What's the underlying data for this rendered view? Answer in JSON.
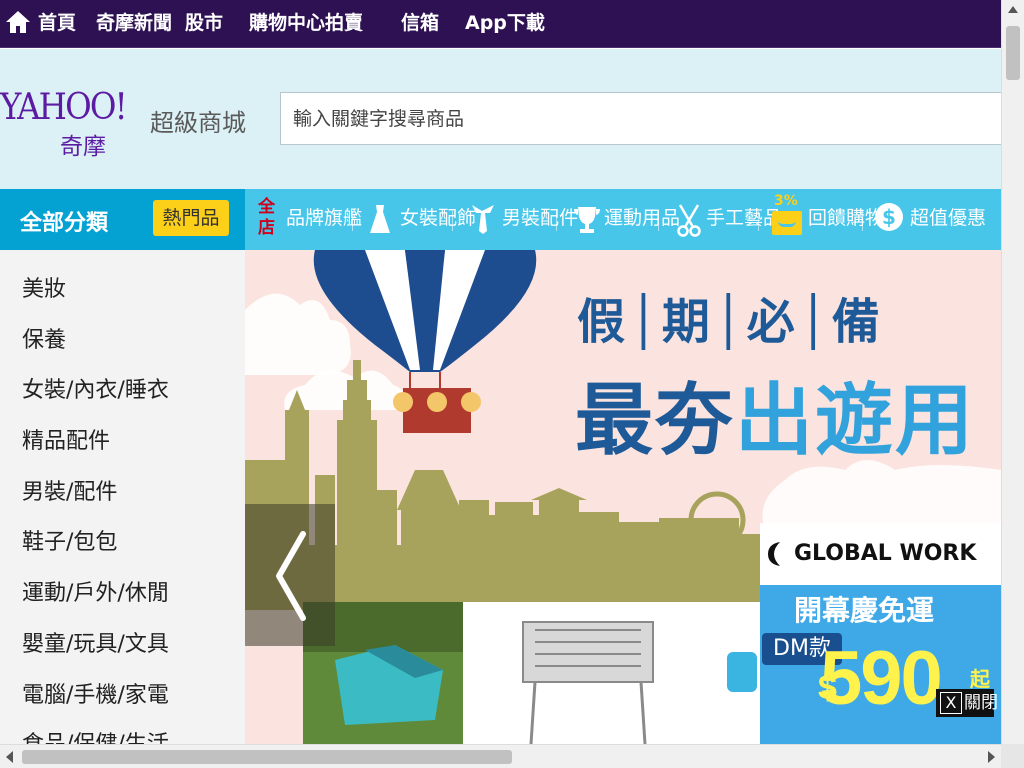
{
  "topnav": {
    "items": [
      "首頁",
      "奇摩新聞",
      "股市",
      "購物中心",
      "拍賣",
      "信箱",
      "App下載"
    ],
    "home_icon": "home-icon",
    "background": "#2d1152"
  },
  "header": {
    "logo_text": "YAHOO!",
    "logo_chinese": "奇摩",
    "mall_name": "超級商城",
    "search_placeholder": "輸入關鍵字搜尋商品",
    "background": "#dcf1f6"
  },
  "categorybar": {
    "all_categories": "全部分類",
    "hot_badge": "熱門品",
    "links": [
      {
        "label": "品牌旗艦",
        "icon": "all-store-icon",
        "icon_text": "全店"
      },
      {
        "label": "女裝配飾",
        "icon": "dress-icon"
      },
      {
        "label": "男裝配件",
        "icon": "tie-icon"
      },
      {
        "label": "運動用品",
        "icon": "trophy-icon"
      },
      {
        "label": "手工藝品",
        "icon": "scissors-icon"
      },
      {
        "label": "回饋購物",
        "icon": "cashback-icon",
        "icon_text": "3%"
      },
      {
        "label": "超值優惠",
        "icon": "dollar-coin-icon"
      }
    ],
    "background": "#47c6ea",
    "accent": "#04a2d3"
  },
  "sidebar": {
    "items": [
      "美妝",
      "保養",
      "女裝/內衣/睡衣",
      "精品配件",
      "男裝/配件",
      "鞋子/包包",
      "運動/戶外/休閒",
      "嬰童/玩具/文具",
      "電腦/手機/家電",
      "食品/保健/生活"
    ]
  },
  "banner": {
    "headline_small": "假│期│必│備",
    "headline_big_part1": "最夯",
    "headline_big_part2": "出遊用",
    "prev_icon": "chevron-left-icon"
  },
  "ad": {
    "brand": "GLOBAL WORK",
    "line1": "開幕慶免運",
    "dm_label": "DM款",
    "currency": "$",
    "price": "590",
    "suffix": "起",
    "close_label": "關閉",
    "close_icon_text": "X"
  }
}
